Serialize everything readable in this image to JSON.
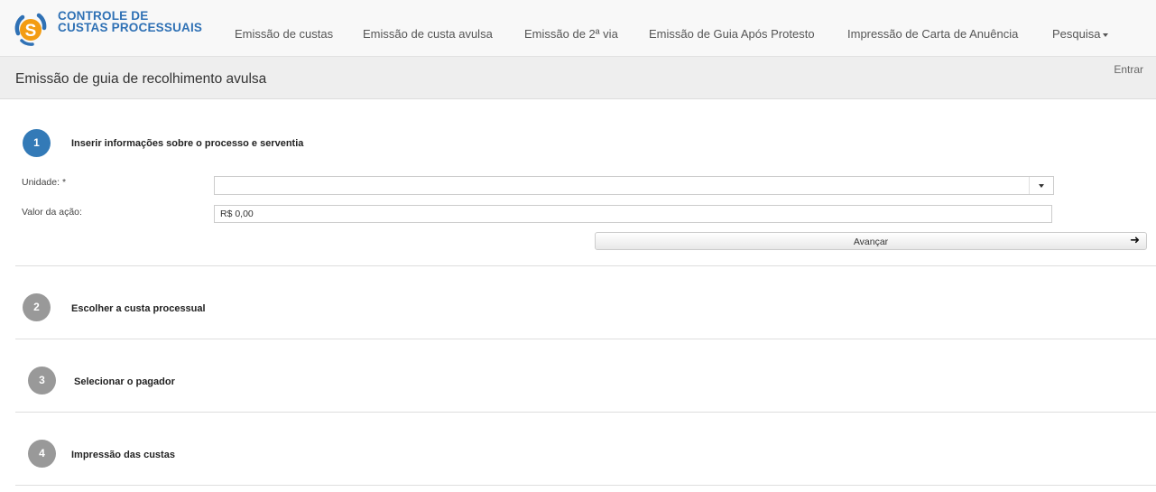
{
  "brand": {
    "line1": "CONTROLE DE",
    "line2": "CUSTAS PROCESSUAIS",
    "colors": {
      "blue": "#2f71b5",
      "orange": "#f39c12"
    }
  },
  "nav": {
    "items": [
      "Emissão de custas",
      "Emissão de custa avulsa",
      "Emissão de 2ª via",
      "Emissão de Guia Após Protesto",
      "Impressão de Carta de Anuência",
      "Pesquisa"
    ]
  },
  "header": {
    "title": "Emissão de guia de recolhimento avulsa",
    "login": "Entrar"
  },
  "steps": [
    {
      "number": "1",
      "title": "Inserir informações sobre o processo e serventia",
      "state": "active"
    },
    {
      "number": "2",
      "title": "Escolher a custa processual",
      "state": "inactive"
    },
    {
      "number": "3",
      "title": "Selecionar o pagador",
      "state": "inactive"
    },
    {
      "number": "4",
      "title": "Impressão das custas",
      "state": "inactive"
    }
  ],
  "form": {
    "unidade_label": "Unidade: *",
    "unidade_value": "",
    "valor_label": "Valor da ação:",
    "valor_value": "R$ 0,00",
    "next_label": "Avançar",
    "next_icon": "arrow-right-icon"
  },
  "colors": {
    "active_step": "#337ab7",
    "inactive_step": "#999999"
  }
}
